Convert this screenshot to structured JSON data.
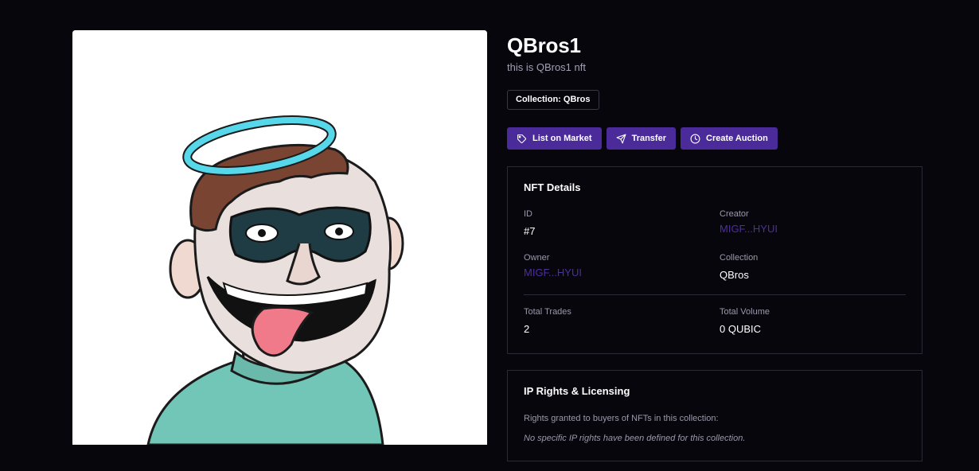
{
  "nft": {
    "title": "QBros1",
    "description": "this is QBros1 nft",
    "collection_badge": "Collection: QBros",
    "image_alt": "QBros cartoon character with halo, mask and tongue out"
  },
  "actions": {
    "list_label": "List on Market",
    "transfer_label": "Transfer",
    "auction_label": "Create Auction"
  },
  "details": {
    "heading": "NFT Details",
    "id_label": "ID",
    "id_value": "#7",
    "creator_label": "Creator",
    "creator_value": "MIGF...HYUI",
    "owner_label": "Owner",
    "owner_value": "MIGF...HYUI",
    "collection_label": "Collection",
    "collection_value": "QBros",
    "trades_label": "Total Trades",
    "trades_value": "2",
    "volume_label": "Total Volume",
    "volume_value": "0 QUBIC"
  },
  "rights": {
    "heading": "IP Rights & Licensing",
    "description": "Rights granted to buyers of NFTs in this collection:",
    "note": "No specific IP rights have been defined for this collection."
  },
  "colors": {
    "background": "#07060d",
    "accent": "#4b2a9a",
    "link": "#4d2f9e",
    "border": "#2b2936"
  },
  "icons": [
    "tag-icon",
    "send-icon",
    "clock-icon"
  ]
}
